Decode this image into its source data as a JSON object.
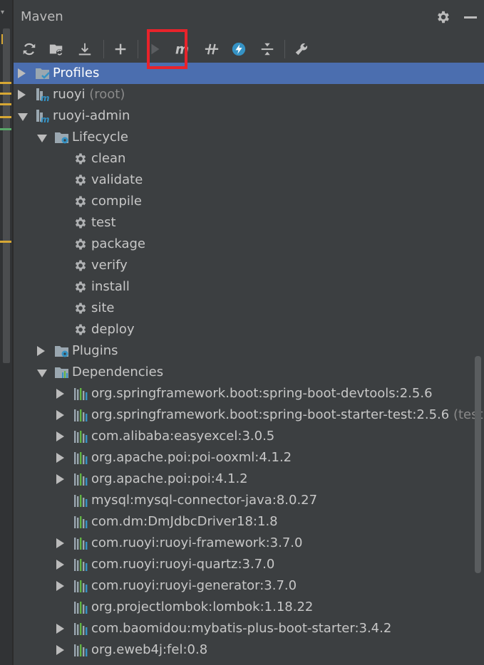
{
  "panel": {
    "title": "Maven"
  },
  "toolbar": {
    "buttons": [
      {
        "name": "reimport-icon"
      },
      {
        "name": "generate-sources-icon"
      },
      {
        "name": "download-icon"
      },
      {
        "name": "add-icon"
      },
      {
        "name": "run-icon"
      },
      {
        "name": "execute-goal-icon",
        "glyph": "m"
      },
      {
        "name": "toggle-offline-icon"
      },
      {
        "name": "skip-tests-icon"
      },
      {
        "name": "show-dependencies-icon"
      },
      {
        "name": "settings-wrench-icon"
      }
    ],
    "highlight_color": "#e8232b"
  },
  "tree": {
    "rows": [
      {
        "label": "Profiles",
        "suffix": "",
        "arrow": "right",
        "icon": "profiles-folder-icon",
        "selected": true
      },
      {
        "label": "ruoyi",
        "suffix": " (root)",
        "arrow": "right",
        "icon": "maven-module-icon"
      },
      {
        "label": "ruoyi-admin",
        "suffix": "",
        "arrow": "down",
        "icon": "maven-module-icon"
      },
      {
        "label": "Lifecycle",
        "suffix": "",
        "arrow": "down",
        "icon": "lifecycle-folder-icon"
      },
      {
        "label": "clean",
        "suffix": "",
        "arrow": "",
        "icon": "gear-icon"
      },
      {
        "label": "validate",
        "suffix": "",
        "arrow": "",
        "icon": "gear-icon"
      },
      {
        "label": "compile",
        "suffix": "",
        "arrow": "",
        "icon": "gear-icon"
      },
      {
        "label": "test",
        "suffix": "",
        "arrow": "",
        "icon": "gear-icon"
      },
      {
        "label": "package",
        "suffix": "",
        "arrow": "",
        "icon": "gear-icon"
      },
      {
        "label": "verify",
        "suffix": "",
        "arrow": "",
        "icon": "gear-icon"
      },
      {
        "label": "install",
        "suffix": "",
        "arrow": "",
        "icon": "gear-icon"
      },
      {
        "label": "site",
        "suffix": "",
        "arrow": "",
        "icon": "gear-icon"
      },
      {
        "label": "deploy",
        "suffix": "",
        "arrow": "",
        "icon": "gear-icon"
      },
      {
        "label": "Plugins",
        "suffix": "",
        "arrow": "right",
        "icon": "plugins-folder-icon"
      },
      {
        "label": "Dependencies",
        "suffix": "",
        "arrow": "down",
        "icon": "dependencies-folder-icon"
      },
      {
        "label": "org.springframework.boot:spring-boot-devtools:2.5.6",
        "suffix": "",
        "arrow": "right",
        "icon": "library-icon"
      },
      {
        "label": "org.springframework.boot:spring-boot-starter-test:2.5.6",
        "suffix": " (test)",
        "arrow": "right",
        "icon": "library-icon"
      },
      {
        "label": "com.alibaba:easyexcel:3.0.5",
        "suffix": "",
        "arrow": "right",
        "icon": "library-icon"
      },
      {
        "label": "org.apache.poi:poi-ooxml:4.1.2",
        "suffix": "",
        "arrow": "right",
        "icon": "library-icon"
      },
      {
        "label": "org.apache.poi:poi:4.1.2",
        "suffix": "",
        "arrow": "right",
        "icon": "library-icon"
      },
      {
        "label": "mysql:mysql-connector-java:8.0.27",
        "suffix": "",
        "arrow": "",
        "icon": "library-icon"
      },
      {
        "label": "com.dm:DmJdbcDriver18:1.8",
        "suffix": "",
        "arrow": "",
        "icon": "library-icon"
      },
      {
        "label": "com.ruoyi:ruoyi-framework:3.7.0",
        "suffix": "",
        "arrow": "right",
        "icon": "library-icon"
      },
      {
        "label": "com.ruoyi:ruoyi-quartz:3.7.0",
        "suffix": "",
        "arrow": "right",
        "icon": "library-icon"
      },
      {
        "label": "com.ruoyi:ruoyi-generator:3.7.0",
        "suffix": "",
        "arrow": "right",
        "icon": "library-icon"
      },
      {
        "label": "org.projectlombok:lombok:1.18.22",
        "suffix": "",
        "arrow": "",
        "icon": "library-icon"
      },
      {
        "label": "com.baomidou:mybatis-plus-boot-starter:3.4.2",
        "suffix": "",
        "arrow": "right",
        "icon": "library-icon"
      },
      {
        "label": "org.eweb4j:fel:0.8",
        "suffix": "",
        "arrow": "right",
        "icon": "library-icon"
      }
    ]
  },
  "colors": {
    "background": "#3c3f41",
    "selection": "#4b6eaf",
    "text": "#bbbbbb",
    "accent_blue": "#3592c4"
  }
}
